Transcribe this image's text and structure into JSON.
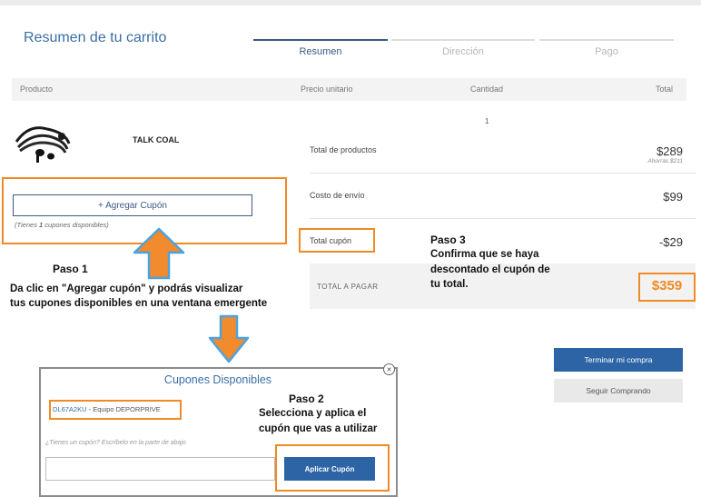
{
  "header": {
    "title": "Resumen de tu carrito",
    "steps": [
      {
        "label": "Resumen",
        "color": "#3a5a84"
      },
      {
        "label": "Dirección",
        "color": "#b7b7b7"
      },
      {
        "label": "Pago",
        "color": "#b7b7b7"
      }
    ]
  },
  "table": {
    "columns": [
      "Producto",
      "Precio unitario",
      "Cantidad",
      "Total"
    ],
    "product": {
      "name": "TALK COAL",
      "quantity": "1"
    }
  },
  "summary": {
    "subtotal_label": "Total de productos",
    "subtotal_value": "$289",
    "savings": "Ahorras $211",
    "shipping_label": "Costo de envío",
    "shipping_value": "$99",
    "coupon_label": "Total cupón",
    "coupon_value": "-$29",
    "total_label": "TOTAL A PAGAR",
    "total_value": "$359"
  },
  "coupon": {
    "add_button": "+ Agregar Cupón",
    "note_prefix": "(Tienes ",
    "note_count": "1",
    "note_suffix": " cupones disponibles)"
  },
  "annotations": {
    "step1_title": "Paso 1",
    "step1_line1": "Da clic en \"Agregar cupón\" y podrás visualizar",
    "step1_line2": "tus cupones disponibles en una ventana emergente",
    "step2_title": "Paso 2",
    "step2_line1": "Selecciona y aplica el",
    "step2_line2": "cupón que vas a utilizar",
    "step3_title": "Paso 3",
    "step3_line1": "Confirma que se haya",
    "step3_line2": "descontado el cupón de",
    "step3_line3": "tu total."
  },
  "actions": {
    "checkout": "Terminar mi compra",
    "continue": "Seguir Comprando"
  },
  "modal": {
    "title": "Cupones Disponibles",
    "coupon_code": "DL67A2KU",
    "coupon_desc": " - Equipo DEPORPRIVE",
    "hint": "¿Tienes un cupón? Escríbelo en la parte de abajo",
    "apply": "Aplicar Cupón",
    "close_glyph": "✕"
  },
  "colors": {
    "accent": "#2c64a6",
    "annotation": "#f08a24",
    "arrow_outline": "#4aa3df"
  },
  "icons": {
    "product_image": "earphones-image",
    "arrow_up": "annotation-arrow-up",
    "arrow_down": "annotation-arrow-down"
  }
}
